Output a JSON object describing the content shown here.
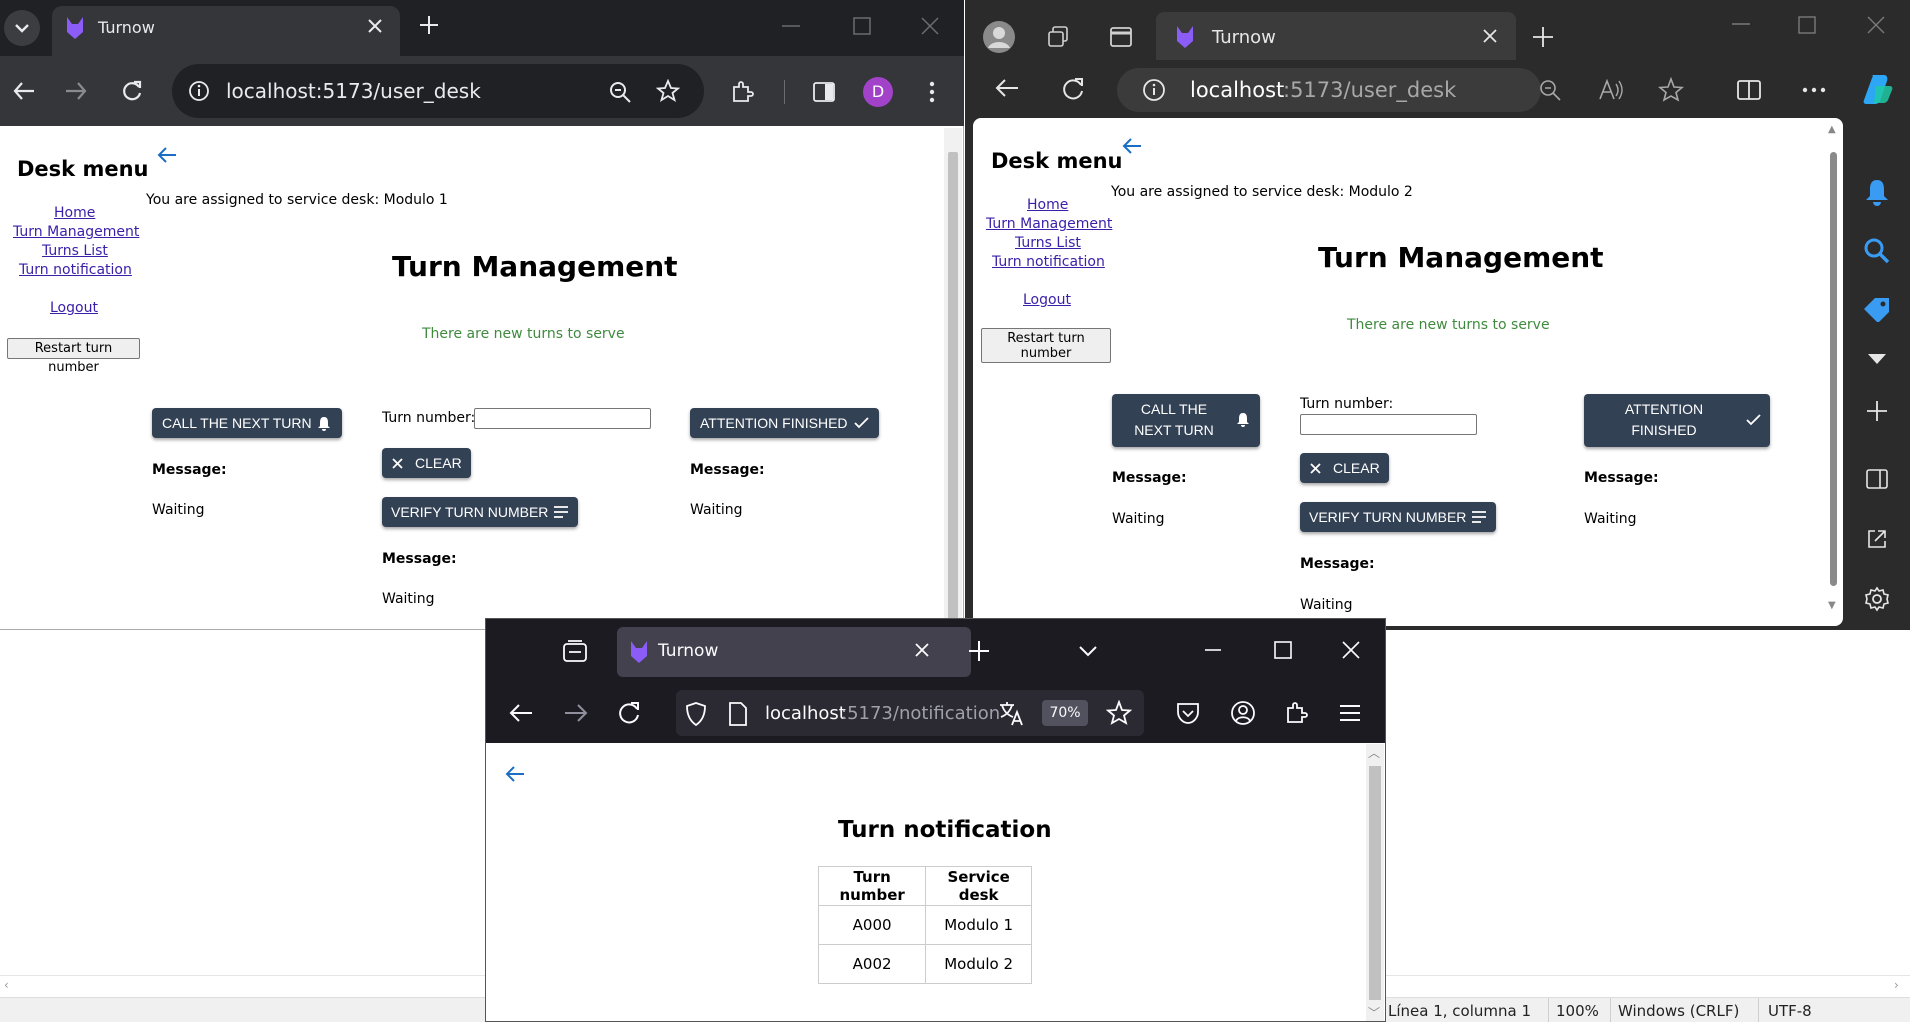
{
  "background": {
    "status": {
      "position": "Línea 1, columna 1",
      "zoom": "100%",
      "line_ending": "Windows (CRLF)",
      "encoding": "UTF-8"
    }
  },
  "chrome": {
    "tab_title": "Turnow",
    "url": "localhost:5173/user_desk",
    "profile_initial": "D",
    "page": {
      "side_title": "Desk menu",
      "menu": [
        "Home",
        "Turn Management",
        "Turns List",
        "Turn notification"
      ],
      "logout": "Logout",
      "restart": "Restart turn number",
      "assigned": "You are assigned to service desk: Modulo 1",
      "title": "Turn Management",
      "notice": "There are new turns to serve",
      "call_next": "CALL THE NEXT TURN",
      "turn_number_label": "Turn number:",
      "turn_number_value": "",
      "clear": "CLEAR",
      "verify": "VERIFY TURN NUMBER",
      "attention": "ATTENTION FINISHED",
      "message_label": "Message:",
      "message_value": "Waiting"
    }
  },
  "edge": {
    "tab_title": "Turnow",
    "url_host": "localhost",
    "url_rest": ":5173/user_desk",
    "page": {
      "side_title": "Desk menu",
      "menu": [
        "Home",
        "Turn Management",
        "Turns List",
        "Turn notification"
      ],
      "logout": "Logout",
      "restart_1": "Restart turn",
      "restart_2": "number",
      "assigned": "You are assigned to service desk: Modulo 2",
      "title": "Turn Management",
      "notice": "There are new turns to serve",
      "call_next_1": "CALL THE",
      "call_next_2": "NEXT TURN",
      "turn_number_label": "Turn number:",
      "turn_number_value": "",
      "clear": "CLEAR",
      "verify": "VERIFY TURN NUMBER",
      "attention_1": "ATTENTION",
      "attention_2": "FINISHED",
      "message_label": "Message:",
      "message_value": "Waiting"
    }
  },
  "firefox": {
    "tab_title": "Turnow",
    "url_host": "localhost",
    "url_rest": ":5173/notification",
    "zoom": "70%",
    "page": {
      "title": "Turn notification",
      "headers": [
        "Turn number",
        "Service desk"
      ],
      "rows": [
        [
          "A000",
          "Modulo 1"
        ],
        [
          "A002",
          "Modulo 2"
        ]
      ]
    }
  },
  "colors": {
    "button": "#334155",
    "notice": "#3f8a3f",
    "link": "#3a1fa8",
    "back_arrow": "#1a6fc4",
    "tab_logo": "#8b5cf6"
  }
}
